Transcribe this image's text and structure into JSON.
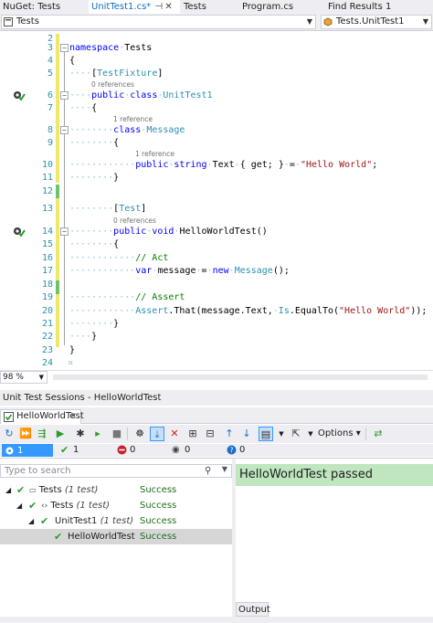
{
  "tabs": [
    {
      "label": "NuGet: Tests"
    },
    {
      "label": "UnitTest1.cs*"
    },
    {
      "label": "Tests"
    },
    {
      "label": "Program.cs"
    },
    {
      "label": "Find Results 1"
    }
  ],
  "nav": {
    "left": "Tests",
    "right": "Tests.UnitTest1"
  },
  "editor": {
    "lines": [
      "2",
      "3",
      "4",
      "5",
      "6",
      "7",
      "8",
      "9",
      "10",
      "11",
      "12",
      "13",
      "14",
      "15",
      "16",
      "17",
      "18",
      "19",
      "20",
      "21",
      "22",
      "23",
      "24"
    ],
    "code": {
      "l3_ns": "namespace",
      "l3_name": "Tests",
      "l4": "{",
      "l5_attr": "TestFixture",
      "l6_ref": "0 references",
      "l6_pub": "public",
      "l6_class": "class",
      "l6_name": "UnitTest1",
      "l7": "{",
      "l8_ref": "1 reference",
      "l8_class": "class",
      "l8_name": "Message",
      "l9": "{",
      "l10_ref": "1 reference",
      "l10_pub": "public",
      "l10_type": "string",
      "l10_prop": "Text",
      "l10_acc": "{ get; }",
      "l10_eq": "=",
      "l10_str": "\"Hello World\"",
      "l10_end": ";",
      "l11": "}",
      "l13_attr": "Test",
      "l14_ref": "0 references",
      "l14_pub": "public",
      "l14_void": "void",
      "l14_name": "HelloWorldTest()",
      "l15": "{",
      "l16": "// Act",
      "l17_var": "var",
      "l17_name": "message",
      "l17_eq": "=",
      "l17_new": "new",
      "l17_type": "Message",
      "l17_end": "();",
      "l19": "// Assert",
      "l20_assert": "Assert",
      "l20_that": ".That(message.Text,",
      "l20_is": "Is",
      "l20_eqto": ".EqualTo(",
      "l20_str": "\"Hello World\"",
      "l20_end": "));",
      "l21": "}",
      "l22": "}",
      "l23": "}"
    }
  },
  "zoom": "98 %",
  "panel": {
    "title": "Unit Test Sessions - HelloWorldTest",
    "session_tab": "HelloWorldTest",
    "options_label": "Options"
  },
  "counts": {
    "all": "1",
    "passed": "1",
    "failed": "0",
    "ignored": "0",
    "unknown": "0"
  },
  "search": {
    "placeholder": "Type to search"
  },
  "tree": [
    {
      "label": "Tests",
      "meta": "(1 test)",
      "status": "Success"
    },
    {
      "label": "Tests",
      "meta": "(1 test)",
      "status": "Success"
    },
    {
      "label": "UnitTest1",
      "meta": "(1 test)",
      "status": "Success"
    },
    {
      "label": "HelloWorldTest",
      "meta": "",
      "status": "Success"
    }
  ],
  "result": "HelloWorldTest passed",
  "output_tab": "Output",
  "colors": {
    "accent": "#0e70c0",
    "success_bg": "#bfe6bf",
    "selection": "#3399ff",
    "change_bar": "#f0e86a",
    "saved_bar": "#6cc46c"
  }
}
